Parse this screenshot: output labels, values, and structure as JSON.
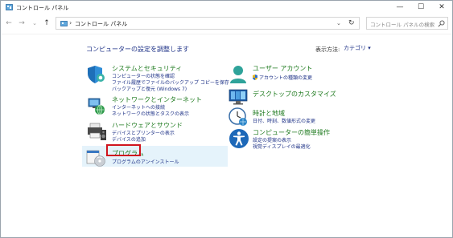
{
  "window": {
    "title": "コントロール パネル",
    "controls": {
      "minimize": "—",
      "maximize": "☐",
      "close": "✕"
    }
  },
  "address_bar": {
    "crumb": "コントロール パネル",
    "separator": "›",
    "search_placeholder": "コントロール パネルの検索"
  },
  "header": {
    "title": "コンピューターの設定を調整します",
    "view_by_label": "表示方法:",
    "view_by_value": "カテゴリ ▾"
  },
  "categories_left": [
    {
      "title": "システムとセキュリティ",
      "links": [
        "コンピューターの状態を確認",
        "ファイル履歴でファイルのバックアップ コピーを保存",
        "バックアップと復元 (Windows 7)"
      ]
    },
    {
      "title": "ネットワークとインターネット",
      "links": [
        "インターネットへの接続",
        "ネットワークの状態とタスクの表示"
      ]
    },
    {
      "title": "ハードウェアとサウンド",
      "links": [
        "デバイスとプリンターの表示",
        "デバイスの追加"
      ]
    },
    {
      "title": "プログラム",
      "links": [
        "プログラムのアンインストール"
      ]
    }
  ],
  "categories_right": [
    {
      "title": "ユーザー アカウント",
      "links": [
        "アカウントの種類の変更"
      ]
    },
    {
      "title": "デスクトップのカスタマイズ",
      "links": []
    },
    {
      "title": "時計と地域",
      "links": [
        "日付、時刻、数値形式の変更"
      ]
    },
    {
      "title": "コンピューターの簡単操作",
      "links": [
        "設定の提案の表示",
        "視覚ディスプレイの最適化"
      ]
    }
  ],
  "colors": {
    "category_title": "#1e7a1e",
    "link": "#1e3287",
    "highlight": "#d0141e"
  }
}
